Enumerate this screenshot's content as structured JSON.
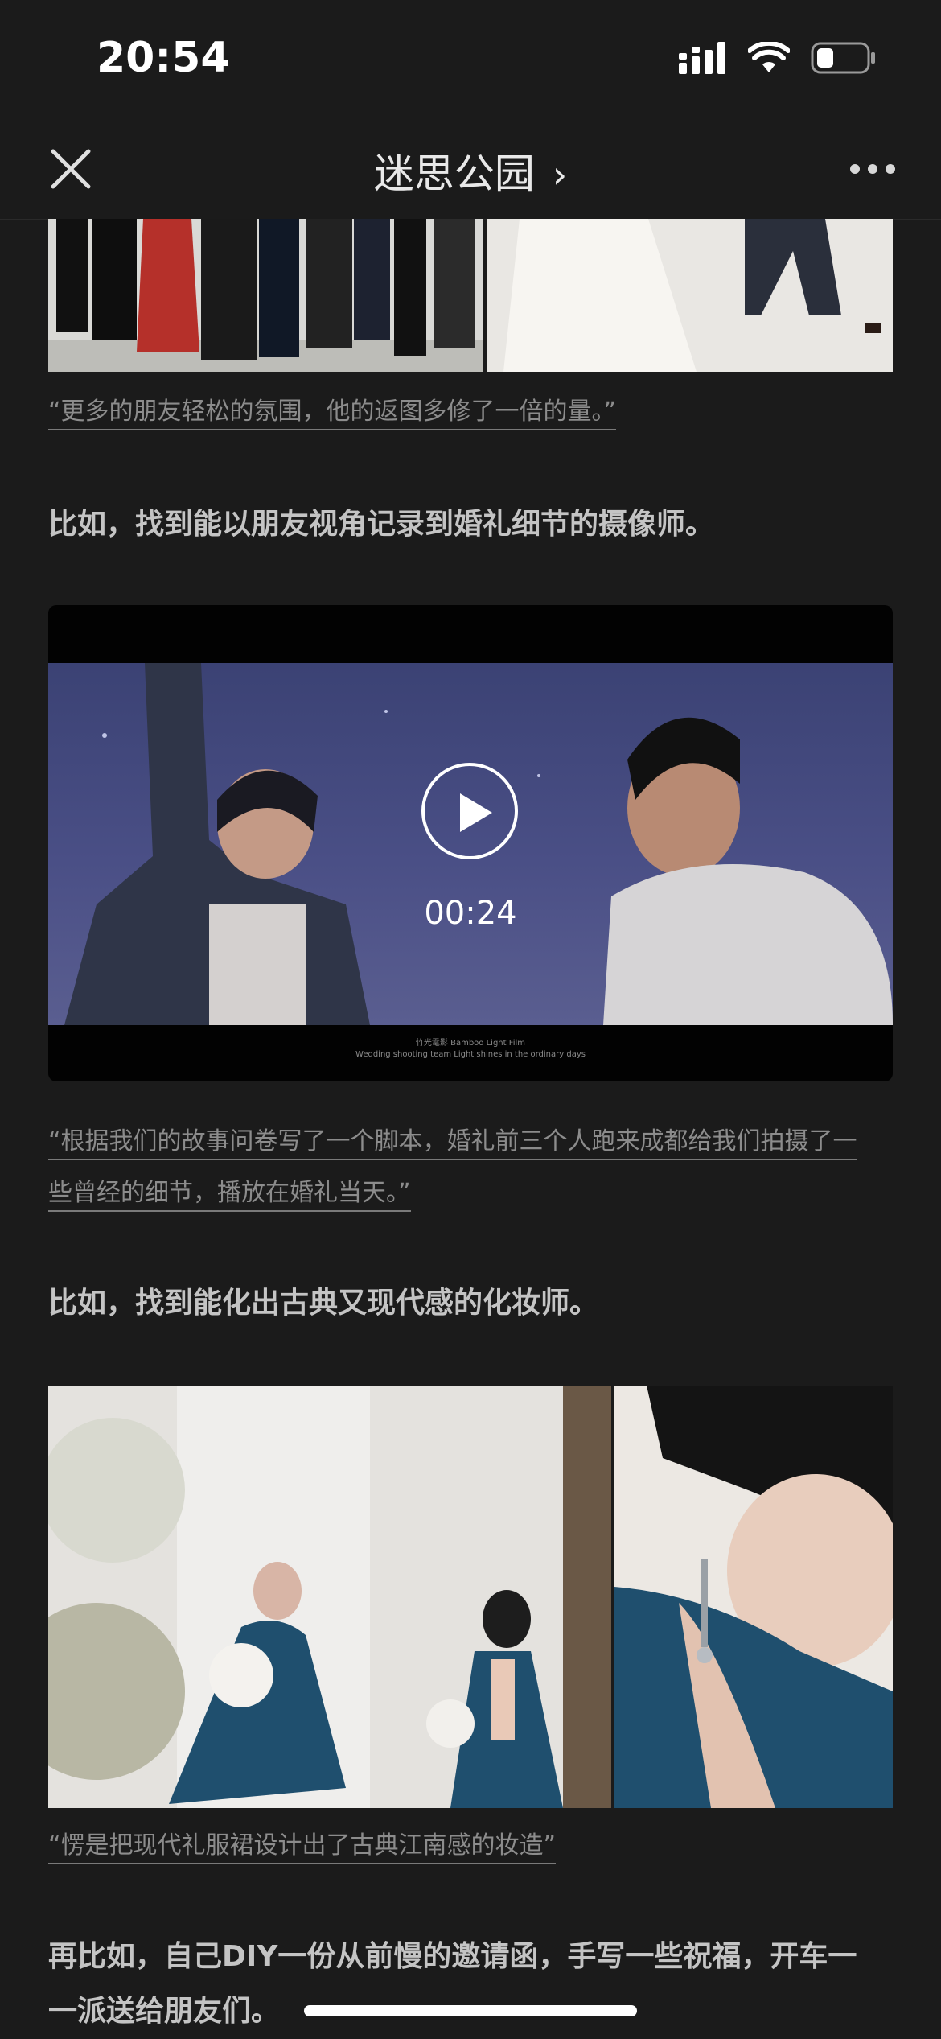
{
  "status_bar": {
    "time": "20:54",
    "icons": [
      "signal-icon",
      "wifi-icon",
      "battery-icon"
    ]
  },
  "nav": {
    "title": "迷思公园",
    "icons": [
      "close-icon",
      "chevron-right-icon",
      "more-icon"
    ]
  },
  "article": {
    "caption_1": "“更多的朋友轻松的氛围，他的返图多修了一倍的量。”",
    "para_1": "比如，找到能以朋友视角记录到婚礼细节的摄像师。",
    "video": {
      "duration": "00:24",
      "watermark_line1": "竹光電影 Bamboo Light Film",
      "watermark_line2": "Wedding shooting team Light shines in the ordinary days"
    },
    "caption_2_line1": "“根据我们的故事问卷写了一个脚本，婚礼前三个人跑来成都给我们拍摄了一",
    "caption_2_line2": "些曾经的细节，播放在婚礼当天。”",
    "para_2": "比如，找到能化出古典又现代感的化妆师。",
    "caption_3": "“愣是把现代礼服裙设计出了古典江南感的妆造”",
    "para_3_line1": "再比如，自己DIY一份从前慢的邀请函，手写一些祝福，开车一",
    "para_3_line2": "一派送给朋友们。"
  },
  "colors": {
    "background": "#1b1b1b",
    "caption": "#8c8c8c",
    "body_text": "#c4c4c4",
    "dress_teal": "#1f4f6e"
  }
}
